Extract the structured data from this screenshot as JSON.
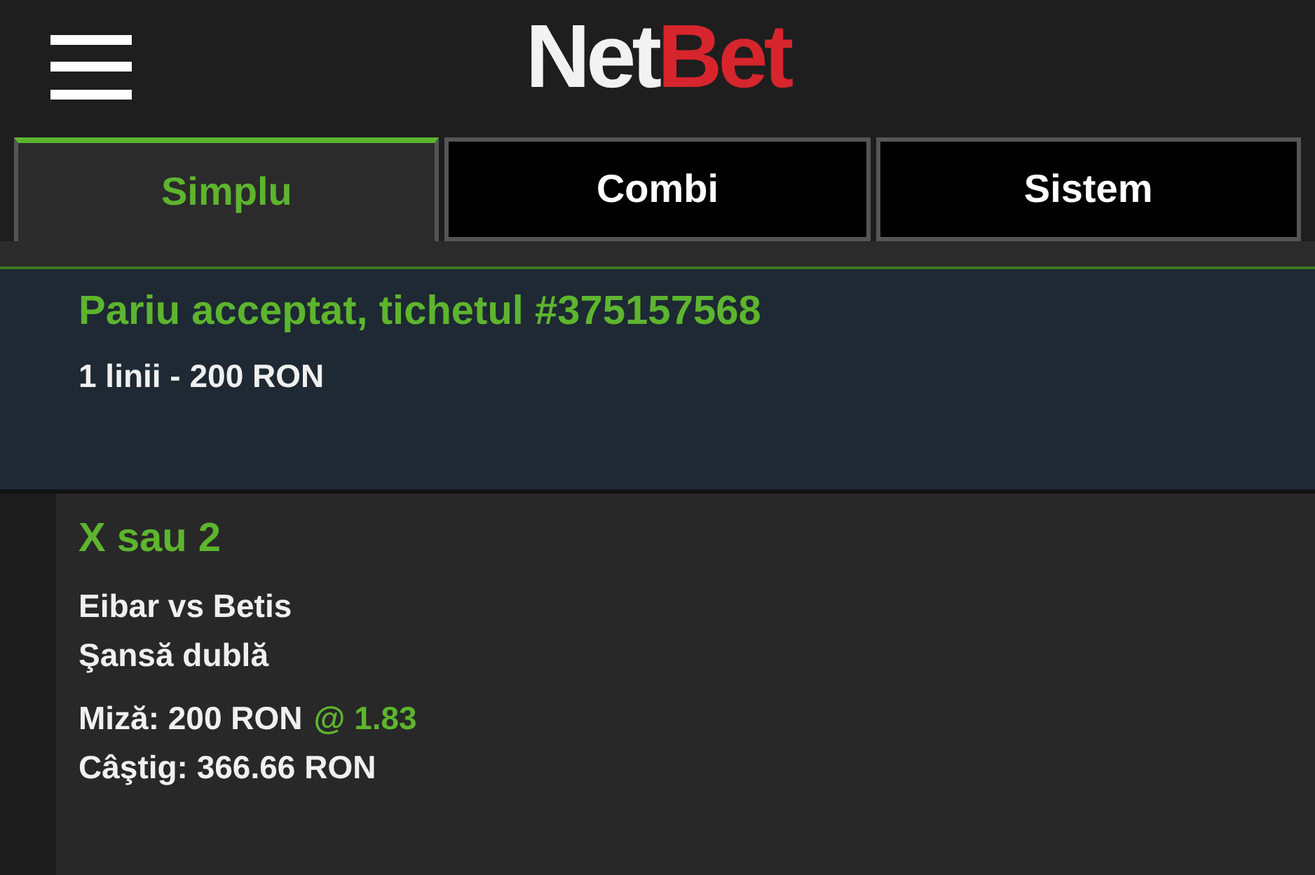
{
  "header": {
    "logo_primary": "Net",
    "logo_accent": "Bet"
  },
  "tabs": [
    {
      "label": "Simplu",
      "selected": true
    },
    {
      "label": "Combi",
      "selected": false
    },
    {
      "label": "Sistem",
      "selected": false
    }
  ],
  "confirmation": {
    "title": "Pariu acceptat, tichetul #375157568",
    "summary": "1 linii - 200 RON"
  },
  "bet": {
    "selection": "X sau 2",
    "event": "Eibar vs Betis",
    "market": "Şansă dublă",
    "stake": "Miză: 200 RON",
    "odds": "@ 1.83",
    "winnings": "Câştig: 366.66 RON"
  }
}
